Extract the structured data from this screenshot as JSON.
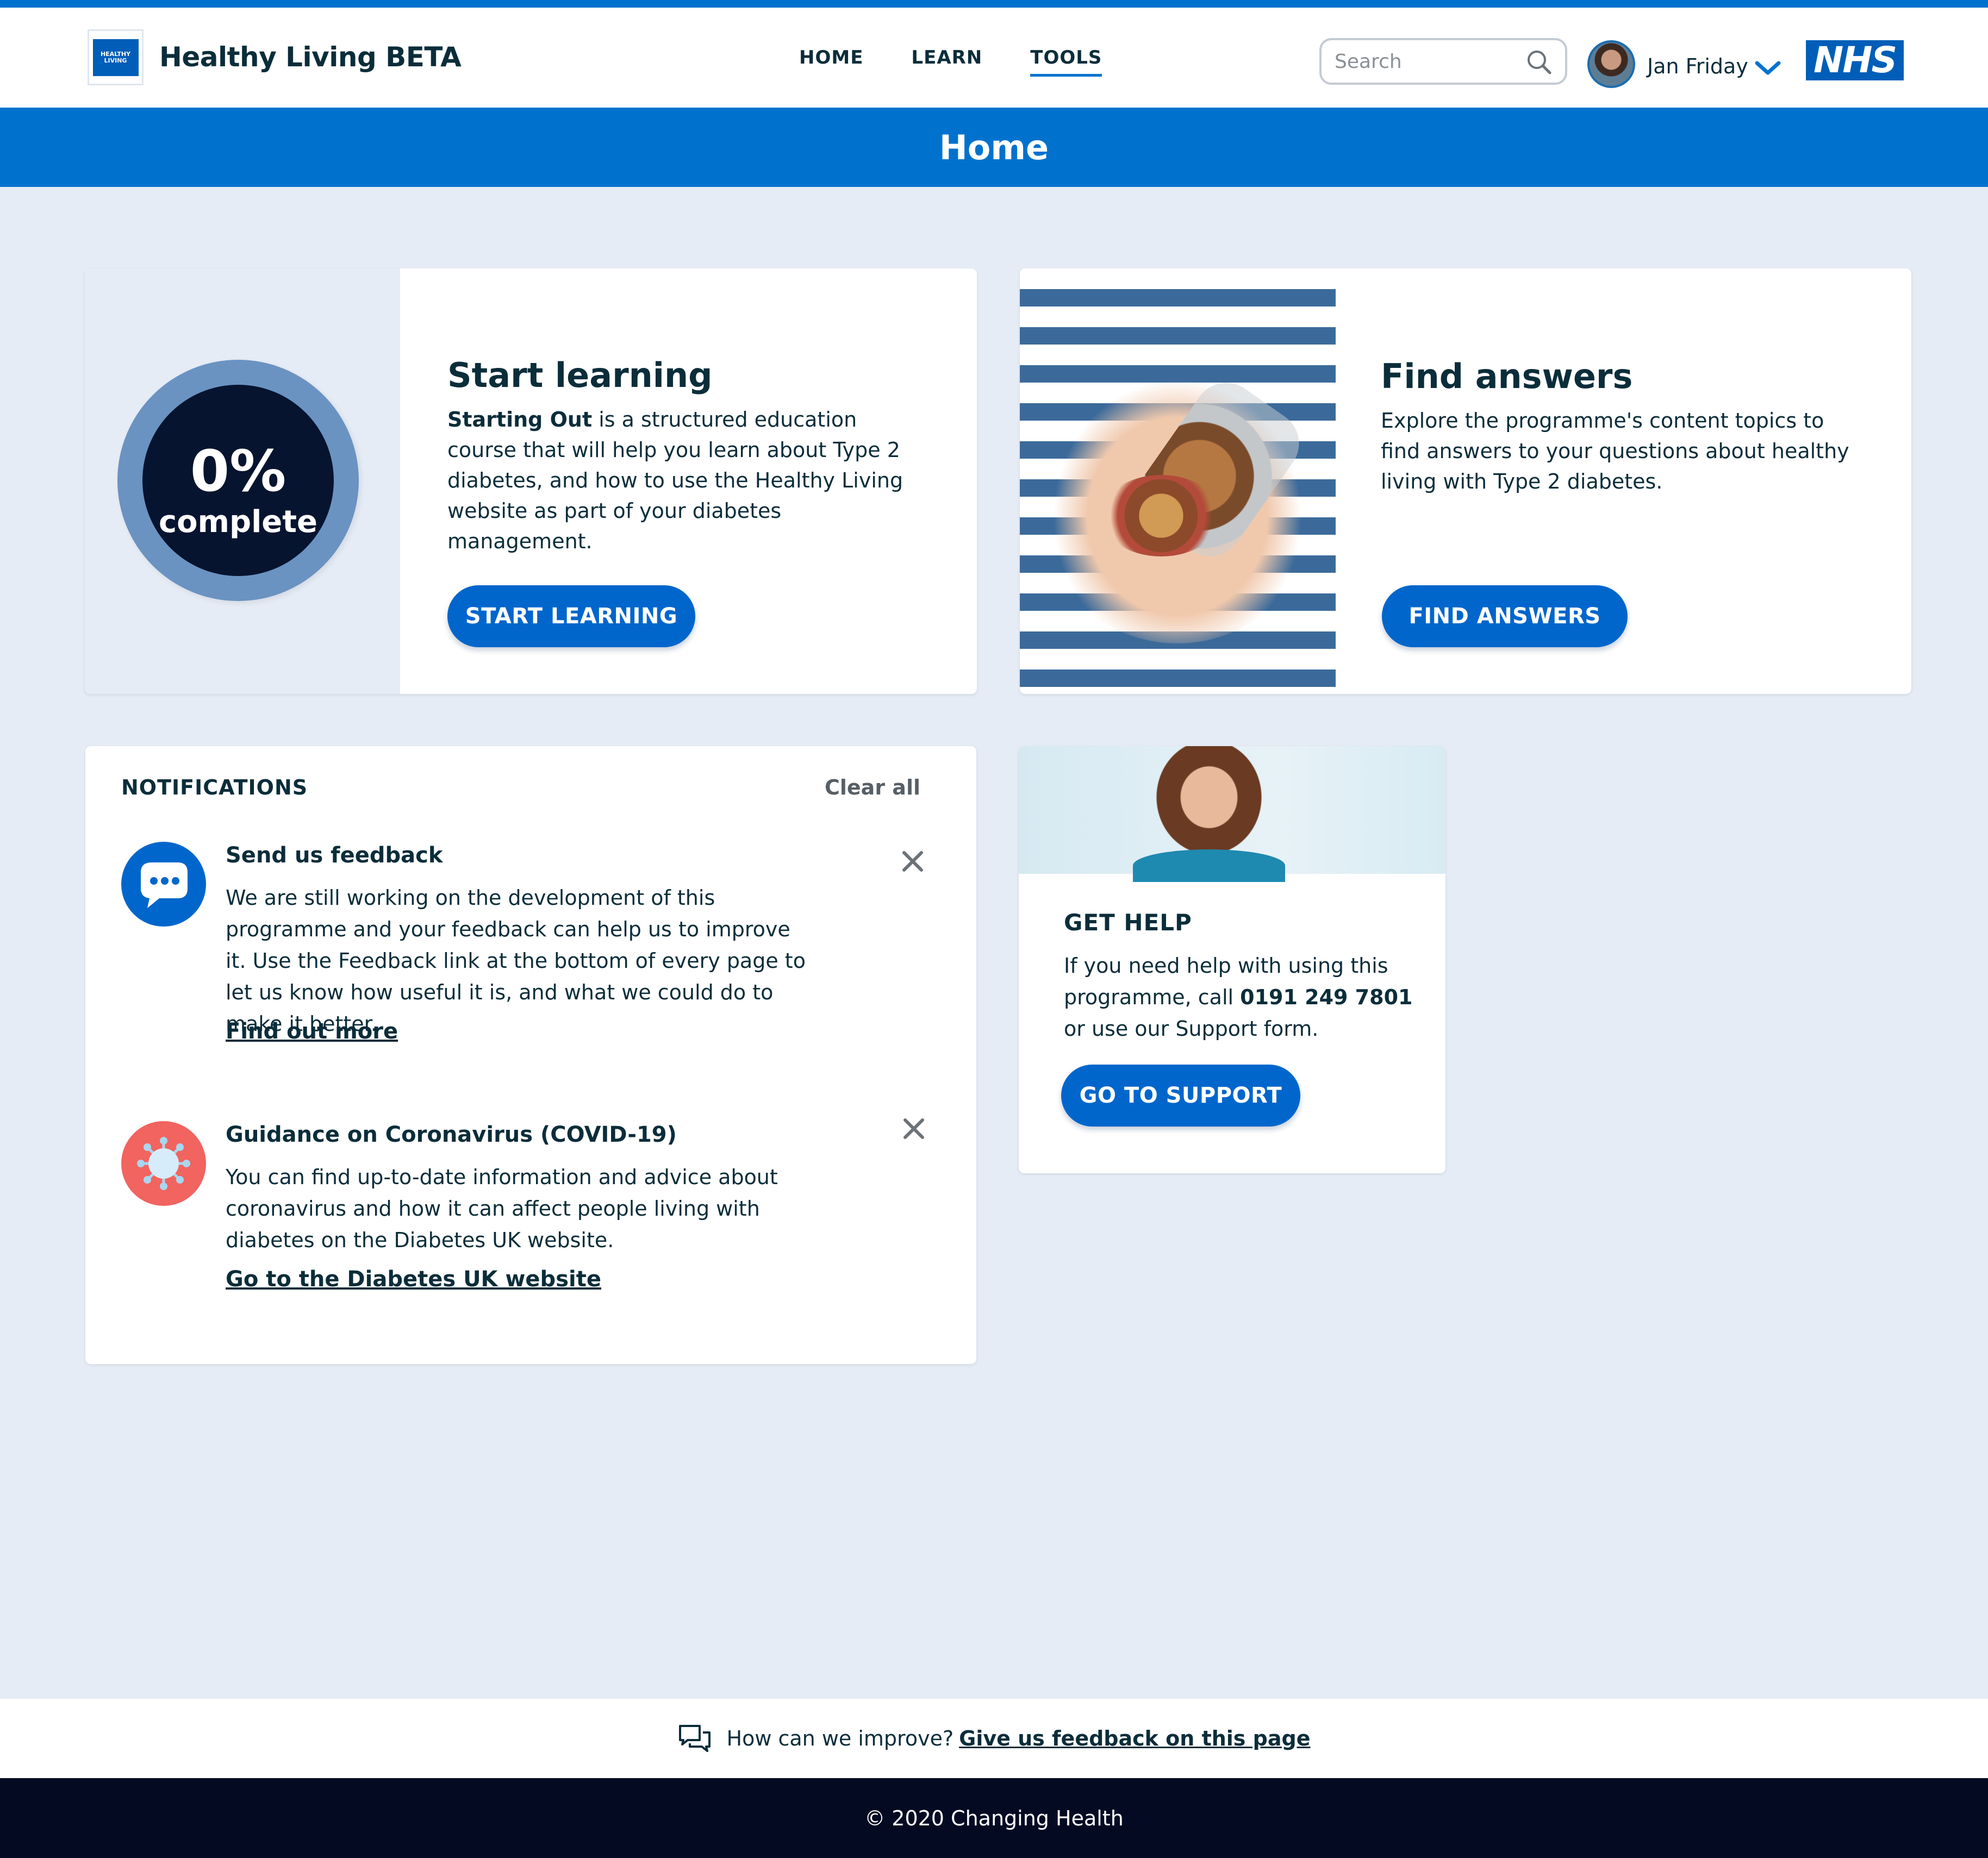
{
  "header": {
    "logo_text": "HEALTHY LIVING",
    "app_title": "Healthy Living BETA",
    "nav": [
      {
        "label": "HOME",
        "active": false
      },
      {
        "label": "LEARN",
        "active": false
      },
      {
        "label": "TOOLS",
        "active": true
      }
    ],
    "search_placeholder": "Search",
    "user_name": "Jan Friday",
    "partner_logo": "NHS"
  },
  "page": {
    "title": "Home"
  },
  "learn_card": {
    "progress_percent": "0%",
    "progress_label": "complete",
    "title": "Start learning",
    "body_bold": "Starting Out",
    "body_rest": " is a structured education course that will help you learn about Type 2 diabetes, and how to use the Healthy Living website as part of your diabetes management.",
    "button_label": "START LEARNING"
  },
  "answers_card": {
    "title": "Find answers",
    "body": "Explore the programme's content topics to find answers to your questions about healthy living with Type 2 diabetes.",
    "button_label": "FIND ANSWERS"
  },
  "notifications": {
    "heading": "NOTIFICATIONS",
    "clear_all": "Clear all",
    "items": [
      {
        "icon": "chat-bubble-icon",
        "title": "Send us feedback",
        "body": "We are still working on the development of this programme and your feedback can help us to improve it. Use the Feedback link at the bottom of every page to let us know how useful it is, and what we could do to make it better.",
        "link": "Find out more"
      },
      {
        "icon": "virus-icon",
        "title": "Guidance on Coronavirus (COVID-19)",
        "body": "You can find up-to-date information and advice about coronavirus and how it can affect people living with diabetes on the Diabetes UK website.",
        "link": "Go to the Diabetes UK website"
      }
    ]
  },
  "help_card": {
    "title": "GET HELP",
    "body_start": "If you need help with using this programme, call ",
    "phone": "0191 249 7801",
    "body_end": " or use our Support form.",
    "button_label": "GO TO SUPPORT"
  },
  "feedback_bar": {
    "prompt": "How can we improve?",
    "link": "Give us feedback on this page"
  },
  "footer": {
    "copyright": "© 2020 Changing Health"
  },
  "colors": {
    "brand_blue": "#0072ce",
    "button_blue": "#0066cc",
    "dark_navy": "#040a22",
    "page_bg": "#e6ecf5",
    "progress_ring": "#6a93c2",
    "covid_red": "#f1645f"
  }
}
